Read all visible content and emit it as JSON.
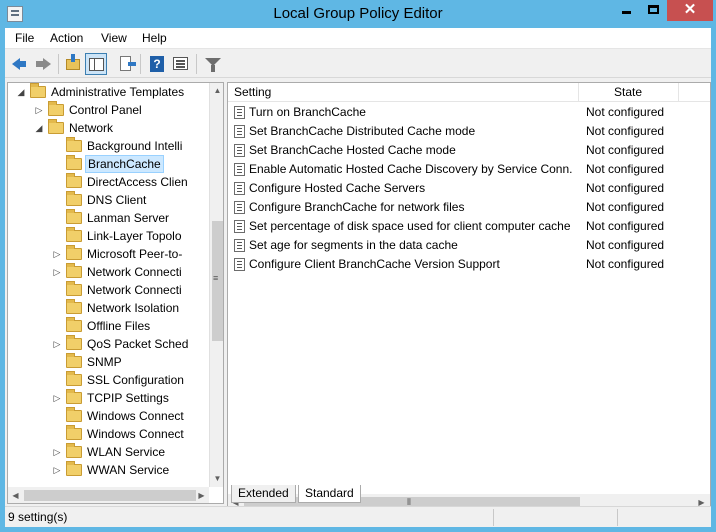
{
  "window": {
    "title": "Local Group Policy Editor",
    "close_glyph": "✕"
  },
  "menu": [
    {
      "label": "File"
    },
    {
      "label": "Action"
    },
    {
      "label": "View"
    },
    {
      "label": "Help"
    }
  ],
  "toolbar": {
    "icons": [
      "back-arrow-icon",
      "forward-arrow-icon",
      "up-one-level-icon",
      "show-hide-console-tree-icon",
      "export-list-icon",
      "help-icon",
      "properties-pane-icon",
      "filter-icon"
    ],
    "accent": "#2f78c4"
  },
  "tree": {
    "items": [
      {
        "label": "Administrative Templates",
        "expander": "◢"
      },
      {
        "label": "Control Panel",
        "expander": "▷"
      },
      {
        "label": "Network",
        "expander": "◢"
      },
      {
        "label": "Background Intelli",
        "expander": ""
      },
      {
        "label": "BranchCache",
        "expander": "",
        "selected": true
      },
      {
        "label": "DirectAccess Clien",
        "expander": ""
      },
      {
        "label": "DNS Client",
        "expander": ""
      },
      {
        "label": "Lanman Server",
        "expander": ""
      },
      {
        "label": "Link-Layer Topolo",
        "expander": ""
      },
      {
        "label": "Microsoft Peer-to-",
        "expander": "▷"
      },
      {
        "label": "Network Connecti",
        "expander": "▷"
      },
      {
        "label": "Network Connecti",
        "expander": ""
      },
      {
        "label": "Network Isolation",
        "expander": ""
      },
      {
        "label": "Offline Files",
        "expander": ""
      },
      {
        "label": "QoS Packet Sched",
        "expander": "▷"
      },
      {
        "label": "SNMP",
        "expander": ""
      },
      {
        "label": "SSL Configuration",
        "expander": ""
      },
      {
        "label": "TCPIP Settings",
        "expander": "▷"
      },
      {
        "label": "Windows Connect",
        "expander": ""
      },
      {
        "label": "Windows Connect",
        "expander": ""
      },
      {
        "label": "WLAN Service",
        "expander": "▷"
      },
      {
        "label": "WWAN Service",
        "expander": "▷"
      }
    ]
  },
  "list": {
    "columns": {
      "setting": "Setting",
      "state": "State"
    },
    "rows": [
      {
        "setting": "Turn on BranchCache",
        "state": "Not configured"
      },
      {
        "setting": "Set BranchCache Distributed Cache mode",
        "state": "Not configured"
      },
      {
        "setting": "Set BranchCache Hosted Cache mode",
        "state": "Not configured"
      },
      {
        "setting": "Enable Automatic Hosted Cache Discovery by Service Conn...",
        "state": "Not configured"
      },
      {
        "setting": "Configure Hosted Cache Servers",
        "state": "Not configured"
      },
      {
        "setting": "Configure BranchCache for network files",
        "state": "Not configured"
      },
      {
        "setting": "Set percentage of disk space used for client computer cache",
        "state": "Not configured"
      },
      {
        "setting": "Set age for segments in the data cache",
        "state": "Not configured"
      },
      {
        "setting": "Configure Client BranchCache Version Support",
        "state": "Not configured"
      }
    ]
  },
  "tabs": [
    {
      "label": "Extended"
    },
    {
      "label": "Standard",
      "active": true
    }
  ],
  "status": {
    "text": "9 setting(s)"
  },
  "colors": {
    "titlebar": "#5fb7e4",
    "selection": "#cce8ff",
    "close": "#c75050"
  }
}
